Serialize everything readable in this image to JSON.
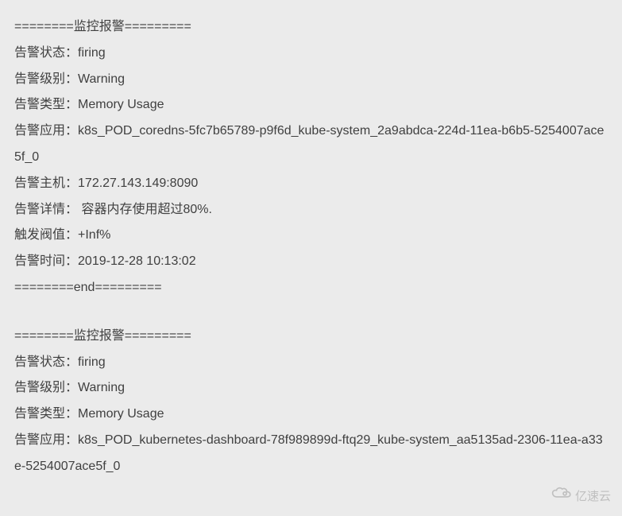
{
  "alerts": [
    {
      "header": "========监控报警=========",
      "rows": [
        {
          "label": "告警状态：",
          "value": "firing"
        },
        {
          "label": "告警级别：",
          "value": "Warning"
        },
        {
          "label": "告警类型：",
          "value": "Memory Usage"
        },
        {
          "label": "告警应用：",
          "value": "k8s_POD_coredns-5fc7b65789-p9f6d_kube-system_2a9abdca-224d-11ea-b6b5-5254007ace5f_0"
        },
        {
          "label": "告警主机：",
          "value": "172.27.143.149:8090"
        },
        {
          "label": "告警详情：",
          "value": " 容器内存使用超过80%."
        },
        {
          "label": "触发阀值：",
          "value": "+Inf%"
        },
        {
          "label": "告警时间：",
          "value": "2019-12-28 10:13:02"
        }
      ],
      "footer": "========end========="
    },
    {
      "header": "========监控报警=========",
      "rows": [
        {
          "label": "告警状态：",
          "value": "firing"
        },
        {
          "label": "告警级别：",
          "value": "Warning"
        },
        {
          "label": "告警类型：",
          "value": "Memory Usage"
        },
        {
          "label": "告警应用：",
          "value": "k8s_POD_kubernetes-dashboard-78f989899d-ftq29_kube-system_aa5135ad-2306-11ea-a33e-5254007ace5f_0"
        }
      ],
      "footer": ""
    }
  ],
  "watermark": {
    "text": "亿速云",
    "icon": "cloud-icon"
  }
}
